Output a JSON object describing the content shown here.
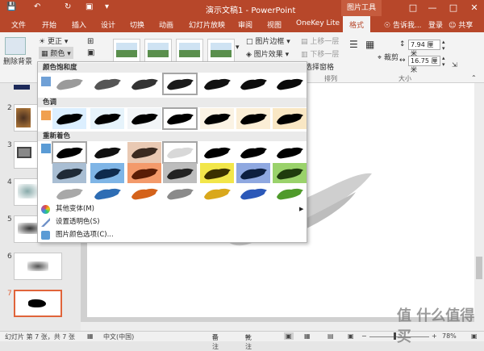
{
  "window": {
    "title": "演示文稿1 - PowerPoint",
    "context_tab": "图片工具"
  },
  "tabs": [
    "文件",
    "开始",
    "插入",
    "设计",
    "切换",
    "动画",
    "幻灯片放映",
    "审阅",
    "视图",
    "OneKey Lite",
    "格式"
  ],
  "tell_me": "告诉我...",
  "login": "登录",
  "share": "共享",
  "ribbon": {
    "remove_bg": "删除背景",
    "corrections": "更正",
    "color": "颜色",
    "border": "图片边框",
    "effects": "图片效果",
    "bring_forward": "上移一层",
    "send_backward": "下移一层",
    "selection_pane": "选择窗格",
    "arrange_label": "排列",
    "crop": "裁剪",
    "height": "7.94 厘米",
    "width": "16.75 厘米",
    "size_label": "大小"
  },
  "dropdown": {
    "saturation_header": "颜色饱和度",
    "tone_header": "色调",
    "recolor_header": "重新着色",
    "more_variations": "其他变体(M)",
    "set_transparent": "设置透明色(S)",
    "picture_options": "图片颜色选项(C)...",
    "saturation_colors": [
      "#9a9a9a",
      "#555555",
      "#333333",
      "#1a1a1a",
      "#111111",
      "#0d0d0d",
      "#0a0a0a"
    ],
    "tone_backgrounds": [
      "#dcefff",
      "#e6f3fb",
      "#f2f5f7",
      "#ffffff",
      "#fbf3e4",
      "#fbeed6",
      "#f9e7c4"
    ],
    "recolor_row1": [
      {
        "fg": "#000000",
        "bg": "#ffffff"
      },
      {
        "fg": "#111111",
        "bg": "#ffffff"
      },
      {
        "fg": "#3a2a20",
        "bg": "#e9c9b3"
      },
      {
        "fg": "#d8d8d8",
        "bg": "#ffffff"
      },
      {
        "fg": "#000000",
        "bg": "#ffffff"
      },
      {
        "fg": "#000000",
        "bg": "#ffffff"
      },
      {
        "fg": "#000000",
        "bg": "#ffffff"
      }
    ],
    "recolor_row2": [
      {
        "fg": "#1f2a36",
        "bg": "#a9bed3"
      },
      {
        "fg": "#0e2a4d",
        "bg": "#7fb5e6"
      },
      {
        "fg": "#5a1d06",
        "bg": "#f39a6b"
      },
      {
        "fg": "#222222",
        "bg": "#bdbdbd"
      },
      {
        "fg": "#3a3000",
        "bg": "#f2e64a"
      },
      {
        "fg": "#0d1f3f",
        "bg": "#8fa8e0"
      },
      {
        "fg": "#1f3b0e",
        "bg": "#9ad26b"
      }
    ],
    "recolor_row3": [
      {
        "fg": "#a8a8a8",
        "bg": "#ffffff"
      },
      {
        "fg": "#2e6db4",
        "bg": "#ffffff"
      },
      {
        "fg": "#d4621a",
        "bg": "#ffffff"
      },
      {
        "fg": "#8a8a8a",
        "bg": "#ffffff"
      },
      {
        "fg": "#d9a81c",
        "bg": "#ffffff"
      },
      {
        "fg": "#2b58b8",
        "bg": "#ffffff"
      },
      {
        "fg": "#4f9a2b",
        "bg": "#ffffff"
      }
    ]
  },
  "slides": {
    "numbers": [
      "2",
      "3",
      "4",
      "5",
      "6",
      "7"
    ],
    "selected": "7"
  },
  "status": {
    "slide_info": "幻灯片 第 7 张，共 7 张",
    "language": "中文(中国)",
    "notes": "备注",
    "comments": "批注",
    "zoom": "78%"
  },
  "watermark": "值 什么值得买",
  "colors": {
    "accent": "#b7472a",
    "selection": "#e0643a"
  }
}
